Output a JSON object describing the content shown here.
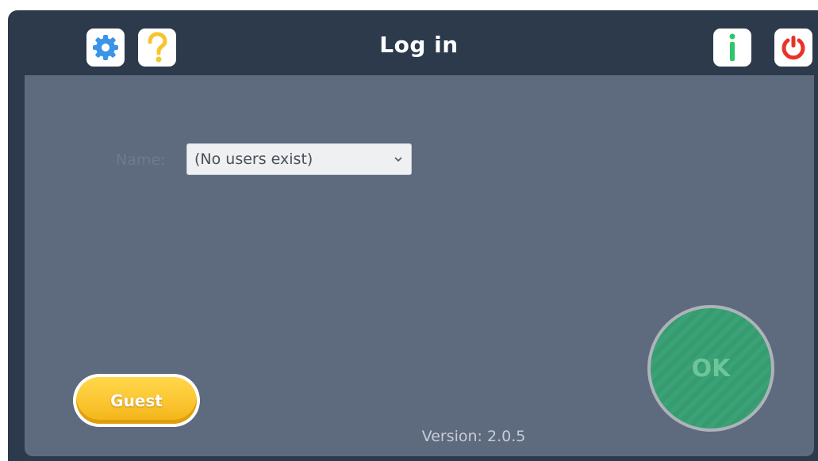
{
  "header": {
    "title": "Log in",
    "icons": {
      "settings": "gear-icon",
      "help": "question-mark-icon",
      "info": "info-icon",
      "power": "power-icon"
    }
  },
  "form": {
    "name_label": "Name:",
    "name_select_value": "(No users exist)"
  },
  "actions": {
    "guest_label": "Guest",
    "ok_label": "OK"
  },
  "footer": {
    "version": "Version: 2.0.5"
  },
  "colors": {
    "header_bg": "#2c3a4c",
    "panel_bg": "#5e6a7e",
    "settings_icon": "#3a95e8",
    "help_icon": "#f8c42c",
    "info_icon": "#2ec56d",
    "power_icon": "#e8332a",
    "guest_button": "#fbc531",
    "ok_button": "#3aa276"
  }
}
